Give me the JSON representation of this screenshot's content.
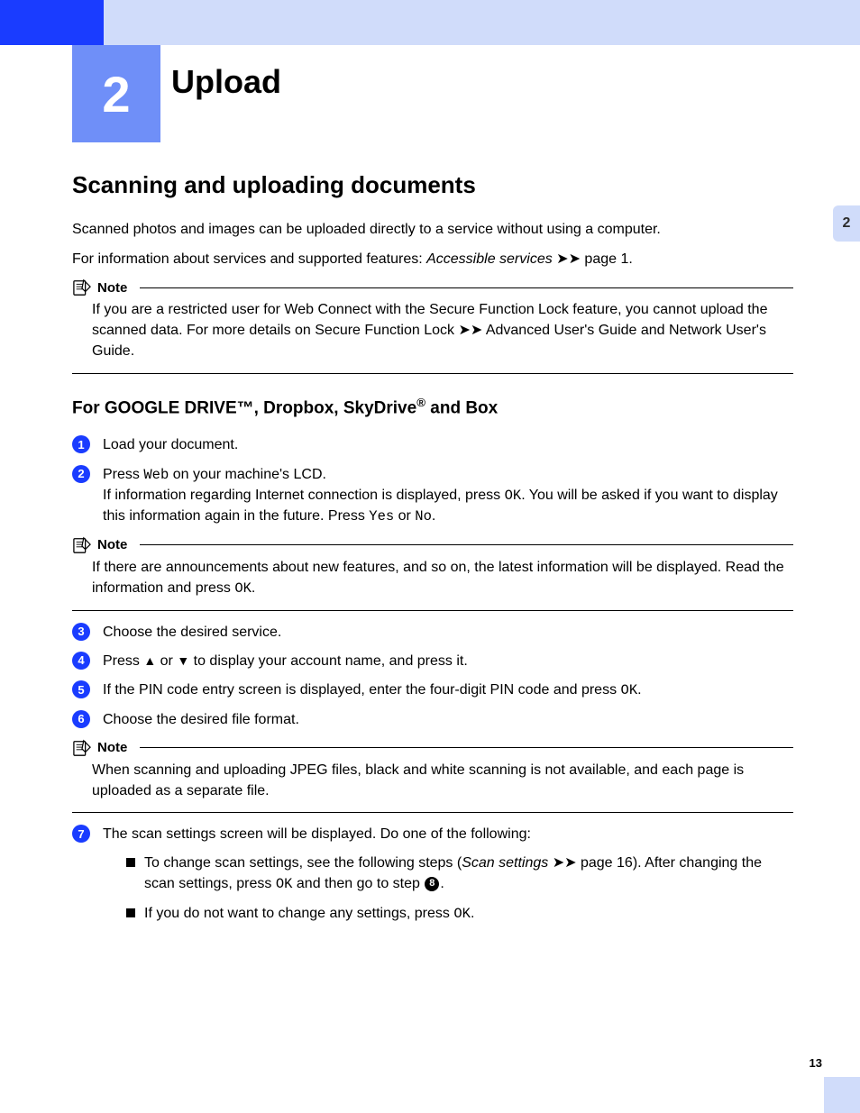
{
  "chapter": {
    "number": "2",
    "title": "Upload"
  },
  "section": {
    "heading": "Scanning and uploading documents"
  },
  "intro": {
    "p1": "Scanned photos and images can be uploaded directly to a service without using a computer.",
    "p2_prefix": "For information about services and supported features: ",
    "p2_ref": "Accessible services",
    "p2_suffix": " page 1."
  },
  "note1": {
    "label": "Note",
    "text_prefix": "If you are a restricted user for Web Connect with the Secure Function Lock feature, you cannot upload the scanned data. For more details on Secure Function Lock ",
    "text_suffix": " Advanced User's Guide and Network User's Guide."
  },
  "subheading": {
    "pre": "For GOOGLE DRIVE™, Dropbox, SkyDrive",
    "sup": "®",
    "post": " and Box"
  },
  "steps": {
    "s1": "Load your document.",
    "s2a": "Press ",
    "s2_web": "Web",
    "s2b": " on your machine's LCD.",
    "s2c": "If information regarding Internet connection is displayed, press ",
    "s2_ok": "OK",
    "s2d": ". You will be asked if you want to display this information again in the future. Press ",
    "s2_yes": "Yes",
    "s2e": " or ",
    "s2_no": "No",
    "s2f": ".",
    "s3": "Choose the desired service.",
    "s4a": "Press ",
    "s4b": " or ",
    "s4c": " to display your account name, and press it.",
    "s5a": "If the PIN code entry screen is displayed, enter the four-digit PIN code and press ",
    "s5_ok": "OK",
    "s5b": ".",
    "s6": "Choose the desired file format.",
    "s7": "The scan settings screen will be displayed. Do one of the following:"
  },
  "note2": {
    "label": "Note",
    "text_a": "If there are announcements about new features, and so on, the latest information will be displayed. Read the information and press ",
    "text_ok": "OK",
    "text_b": "."
  },
  "note3": {
    "label": "Note",
    "text": "When scanning and uploading JPEG files, black and white scanning is not available, and each page is uploaded as a separate file."
  },
  "bullets": {
    "b1a": "To change scan settings, see the following steps (",
    "b1_ref": "Scan settings",
    "b1b": " page 16). After changing the scan settings, press ",
    "b1_ok": "OK",
    "b1c": " and then go to step ",
    "b1_step": "8",
    "b1d": ".",
    "b2a": "If you do not want to change any settings, press ",
    "b2_ok": "OK",
    "b2b": "."
  },
  "sidetab": "2",
  "pagenum": "13"
}
